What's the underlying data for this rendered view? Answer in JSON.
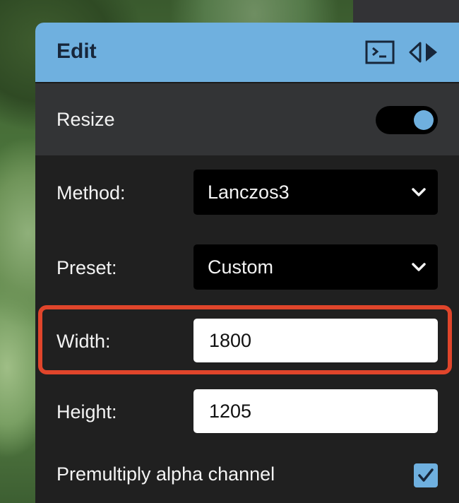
{
  "panel": {
    "title": "Edit",
    "header_icons": [
      "terminal-icon",
      "collapse-arrows-icon"
    ]
  },
  "resize": {
    "label": "Resize",
    "enabled": true
  },
  "fields": {
    "method": {
      "label": "Method:",
      "value": "Lanczos3"
    },
    "preset": {
      "label": "Preset:",
      "value": "Custom"
    },
    "width": {
      "label": "Width:",
      "value": "1800"
    },
    "height": {
      "label": "Height:",
      "value": "1205"
    },
    "premultiply": {
      "label": "Premultiply alpha channel",
      "checked": true
    }
  },
  "colors": {
    "header_bg": "#6fb0df",
    "accent": "#6fb0df",
    "highlight": "#e0452b",
    "panel_bg": "#202020"
  }
}
